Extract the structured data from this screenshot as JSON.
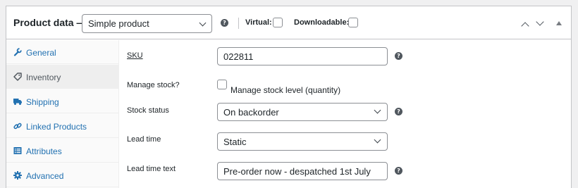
{
  "header": {
    "title": "Product data —",
    "product_type": "Simple product",
    "help_glyph": "?",
    "virtual_label": "Virtual:",
    "virtual_checked": false,
    "downloadable_label": "Downloadable:",
    "downloadable_checked": false
  },
  "tabs": [
    {
      "label": "General",
      "icon": "wrench-icon",
      "active": false
    },
    {
      "label": "Inventory",
      "icon": "tag-icon",
      "active": true
    },
    {
      "label": "Shipping",
      "icon": "truck-icon",
      "active": false
    },
    {
      "label": "Linked Products",
      "icon": "link-icon",
      "active": false
    },
    {
      "label": "Attributes",
      "icon": "list-icon",
      "active": false
    },
    {
      "label": "Advanced",
      "icon": "gear-icon",
      "active": false
    }
  ],
  "fields": {
    "sku": {
      "label": "SKU",
      "value": "022811"
    },
    "manage_stock": {
      "label": "Manage stock?",
      "checkbox_label": "Manage stock level (quantity)",
      "checked": false
    },
    "stock_status": {
      "label": "Stock status",
      "value": "On backorder"
    },
    "lead_time": {
      "label": "Lead time",
      "value": "Static"
    },
    "lead_time_text": {
      "label": "Lead time text",
      "value": "Pre-order now - despatched 1st July"
    }
  },
  "colors": {
    "link": "#2271b1",
    "text": "#1d2327",
    "active_tab_bg": "#eeeeee",
    "border": "#c3c4c7"
  }
}
